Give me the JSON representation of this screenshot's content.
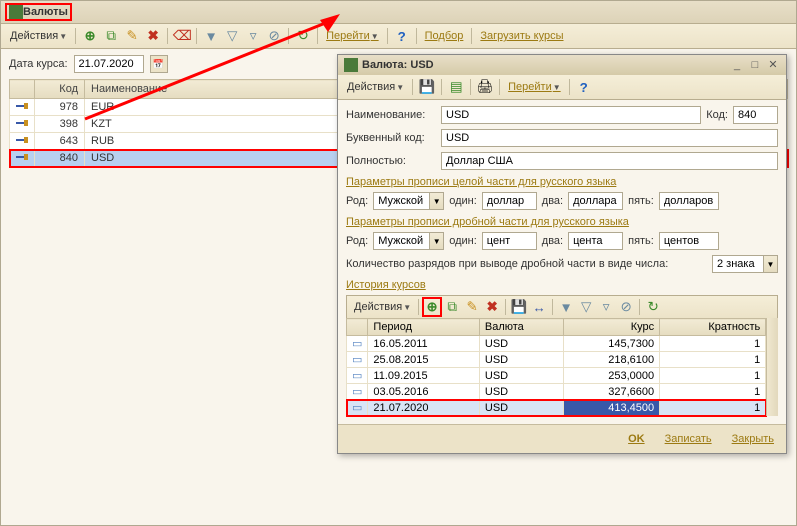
{
  "main": {
    "title": "Валюты",
    "actions_label": "Действия",
    "goto_label": "Перейти",
    "select_label": "Подбор",
    "load_rates_label": "Загрузить курсы",
    "date_label": "Дата курса:",
    "date_value": "21.07.2020",
    "columns": {
      "code": "Код",
      "name": "Наименование"
    },
    "rows": [
      {
        "code": "978",
        "name": "EUR"
      },
      {
        "code": "398",
        "name": "KZT"
      },
      {
        "code": "643",
        "name": "RUB"
      },
      {
        "code": "840",
        "name": "USD"
      }
    ]
  },
  "dialog": {
    "title": "Валюта: USD",
    "actions_label": "Действия",
    "goto_label": "Перейти",
    "name_label": "Наименование:",
    "name_value": "USD",
    "code_label": "Код:",
    "code_value": "840",
    "alpha_label": "Буквенный код:",
    "alpha_value": "USD",
    "full_label": "Полностью:",
    "full_value": "Доллар США",
    "section_integer": "Параметры прописи целой части для русского языка",
    "section_fraction": "Параметры прописи дробной части для русского языка",
    "gender_label": "Род:",
    "gender_value": "Мужской",
    "one_label": "один:",
    "two_label": "два:",
    "five_label": "пять:",
    "int_one": "доллар",
    "int_two": "доллара",
    "int_five": "долларов",
    "frac_one": "цент",
    "frac_two": "цента",
    "frac_five": "центов",
    "digits_label": "Количество разрядов при выводе дробной части в виде числа:",
    "digits_value": "2 знака",
    "history_label": "История курсов",
    "hist_actions": "Действия",
    "hist_columns": {
      "period": "Период",
      "currency": "Валюта",
      "rate": "Курс",
      "mult": "Кратность"
    },
    "hist_rows": [
      {
        "period": "16.05.2011",
        "currency": "USD",
        "rate": "145,7300",
        "mult": "1"
      },
      {
        "period": "25.08.2015",
        "currency": "USD",
        "rate": "218,6100",
        "mult": "1"
      },
      {
        "period": "11.09.2015",
        "currency": "USD",
        "rate": "253,0000",
        "mult": "1"
      },
      {
        "period": "03.05.2016",
        "currency": "USD",
        "rate": "327,6600",
        "mult": "1"
      },
      {
        "period": "21.07.2020",
        "currency": "USD",
        "rate": "413,4500",
        "mult": "1"
      }
    ],
    "ok": "OK",
    "save": "Записать",
    "close": "Закрыть"
  }
}
